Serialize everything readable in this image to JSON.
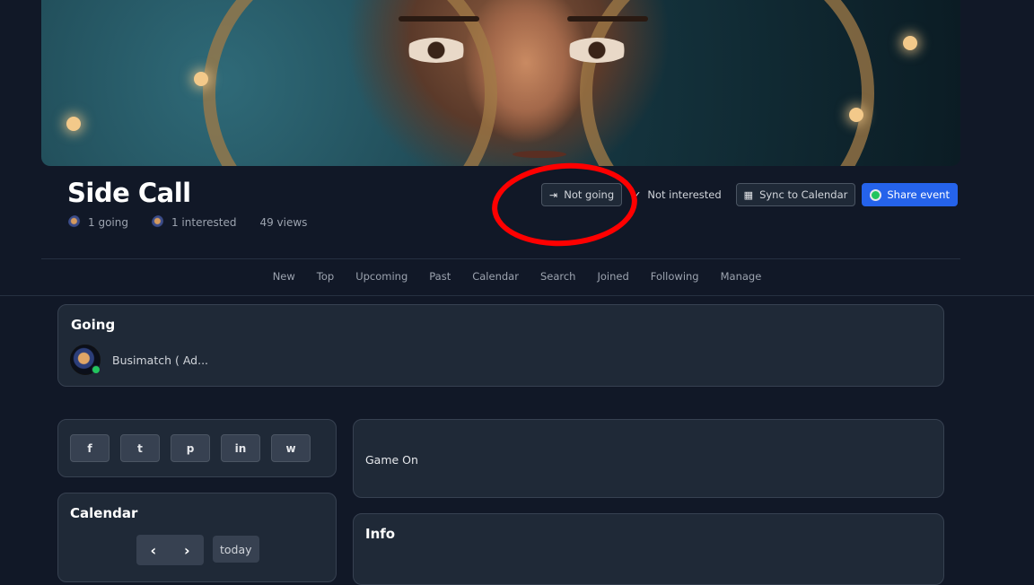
{
  "event": {
    "title": "Side Call",
    "going_count": "1 going",
    "interested_count": "1 interested",
    "views": "49 views"
  },
  "actions": {
    "not_going": "Not going",
    "not_interested": "Not interested",
    "sync_calendar": "Sync to Calendar",
    "share_event": "Share event"
  },
  "nav": [
    "New",
    "Top",
    "Upcoming",
    "Past",
    "Calendar",
    "Search",
    "Joined",
    "Following",
    "Manage"
  ],
  "going": {
    "heading": "Going",
    "attendee": "Busimatch ( Ad..."
  },
  "share": {
    "icons": [
      "facebook-icon",
      "twitter-icon",
      "pinterest-icon",
      "linkedin-icon",
      "whatsapp-icon"
    ],
    "glyphs": [
      "f",
      "t",
      "p",
      "in",
      "w"
    ]
  },
  "description": "Game On",
  "calendar": {
    "heading": "Calendar",
    "prev": "‹",
    "next": "›",
    "today": "today"
  },
  "info": {
    "heading": "Info"
  },
  "colors": {
    "background": "#111827",
    "card": "#1f2937",
    "primary": "#2563eb",
    "annotation": "#ff0000",
    "online": "#22c55e"
  }
}
